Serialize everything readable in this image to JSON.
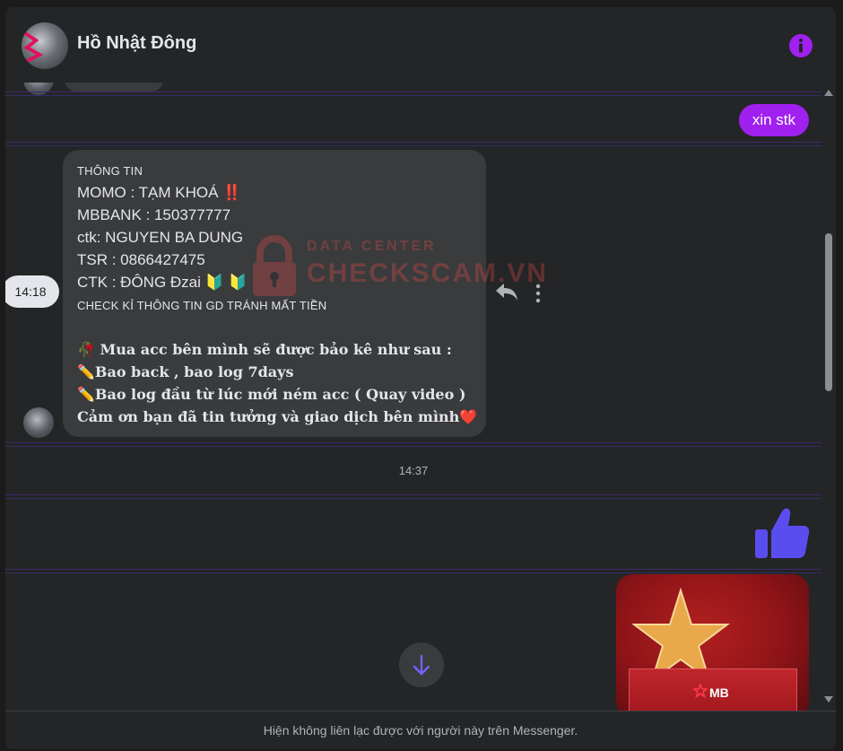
{
  "header": {
    "name": "Hồ Nhật Đông"
  },
  "messages": {
    "me_text": "xin stk",
    "them_time": "14:18",
    "lines": [
      "THÔNG TIN",
      "MOMO : TẠM KHOÁ ‼️",
      "MBBANK : 150377777",
      "ctk: NGUYEN BA DUNG",
      "TSR : 0866427475",
      "CTK : ĐÔNG Đzai 🔰 🔰",
      "CHECK KỈ THÔNG TIN GD TRÁNH MẤT TIỀN",
      "🥀 Mua acc bên mình sẽ được bảo kê như sau :",
      "✏️Bao back , bao log 7days",
      "✏️Bao log đầu từ lúc mới ném acc ( Quay video )",
      "Cảm ơn bạn đã tin tưởng và giao dịch bên mình❤️"
    ],
    "time_separator": "14:37",
    "image_label": "MB"
  },
  "watermark": {
    "top": "DATA CENTER",
    "main": "CHECKSCAM.VN"
  },
  "footer": {
    "text": "Hiện không liên lạc được với người này trên Messenger."
  },
  "colors": {
    "accent": "#a020f0",
    "like": "#5a4df0",
    "bubble_in": "#3a3b3c",
    "background": "#242526"
  }
}
